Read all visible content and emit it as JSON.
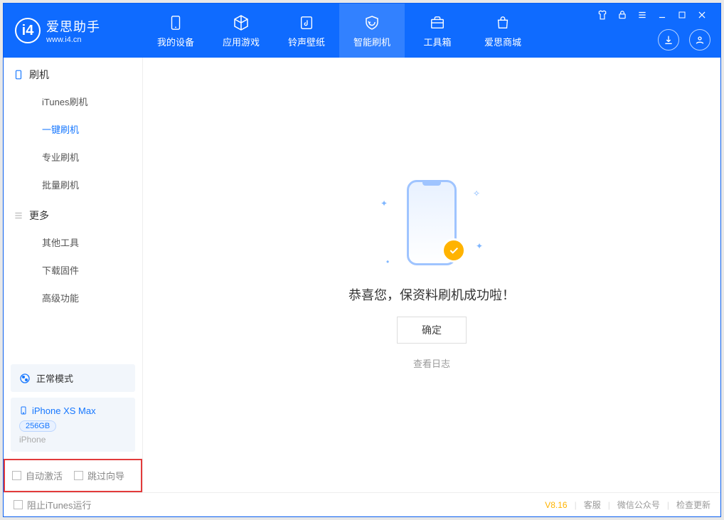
{
  "brand": {
    "name": "爱思助手",
    "url": "www.i4.cn"
  },
  "nav": {
    "tabs": [
      {
        "label": "我的设备"
      },
      {
        "label": "应用游戏"
      },
      {
        "label": "铃声壁纸"
      },
      {
        "label": "智能刷机"
      },
      {
        "label": "工具箱"
      },
      {
        "label": "爱思商城"
      }
    ]
  },
  "sidebar": {
    "section1": {
      "title": "刷机",
      "items": [
        {
          "label": "iTunes刷机"
        },
        {
          "label": "一键刷机"
        },
        {
          "label": "专业刷机"
        },
        {
          "label": "批量刷机"
        }
      ]
    },
    "section2": {
      "title": "更多",
      "items": [
        {
          "label": "其他工具"
        },
        {
          "label": "下载固件"
        },
        {
          "label": "高级功能"
        }
      ]
    },
    "mode_label": "正常模式",
    "device": {
      "name": "iPhone XS Max",
      "storage": "256GB",
      "type": "iPhone"
    },
    "checkboxes": {
      "auto_activate": "自动激活",
      "skip_wizard": "跳过向导"
    }
  },
  "main": {
    "success_message": "恭喜您，保资料刷机成功啦！",
    "ok_button": "确定",
    "log_link": "查看日志"
  },
  "statusbar": {
    "block_itunes": "阻止iTunes运行",
    "version": "V8.16",
    "links": {
      "support": "客服",
      "wechat": "微信公众号",
      "check_update": "检查更新"
    }
  }
}
